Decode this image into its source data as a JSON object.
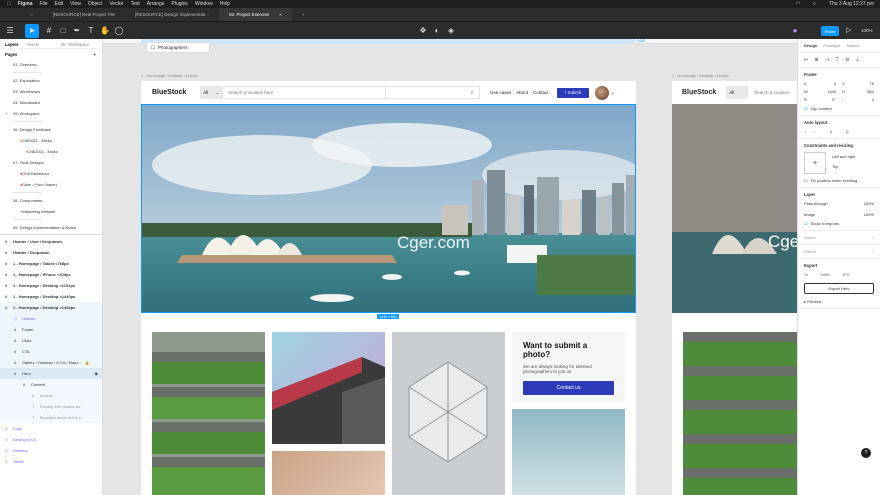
{
  "menubar": {
    "app": "Figma",
    "items": [
      "File",
      "Edit",
      "View",
      "Object",
      "Vector",
      "Text",
      "Arrange",
      "Plugins",
      "Window",
      "Help"
    ],
    "clock": "Thu 3 Aug  12:27 pm"
  },
  "tabs": [
    "[RESOURCE] Real Project File",
    "[RESOURCE] Design Implementati...",
    "03. Project Exercise"
  ],
  "toolbar": {
    "share_label": "Share",
    "zoom": "100%"
  },
  "left_panel": {
    "tabs": [
      "Layers",
      "Assets",
      "05. Workspace"
    ],
    "pages_header": "Pages",
    "pages": [
      {
        "label": "01. Overview"
      },
      {
        "label": "02. Exploration"
      },
      {
        "label": "03. Wireframes"
      },
      {
        "label": "04. Moodboard"
      },
      {
        "label": "05. Workspace"
      },
      {
        "label": "06. Design Feedback"
      },
      {
        "label": "2/8/2021 - Mizko"
      },
      {
        "label": "2/8/2021 - Mizko"
      },
      {
        "label": "07. Final Designs"
      },
      {
        "label": "Grid Behaviour"
      },
      {
        "label": "Date - (Your Name)"
      },
      {
        "label": "08. Components"
      },
      {
        "label": "Marketing Website"
      },
      {
        "label": "09. Design Implementation & Notes"
      }
    ],
    "layers": [
      {
        "label": "Header / User / Dropdown"
      },
      {
        "label": "Header / Dropdown"
      },
      {
        "label": "1 - Homepage / Tablet <768px"
      },
      {
        "label": "1 - Homepage / iPhone <320px"
      },
      {
        "label": "1 - Homepage / Desktop >1152px"
      },
      {
        "label": "1 - Homepage / Desktop >1440px"
      },
      {
        "label": "1 - Homepage / Desktop >1440px"
      },
      {
        "label": "Header"
      },
      {
        "label": "Footer"
      },
      {
        "label": "Links"
      },
      {
        "label": "CTA"
      },
      {
        "label": "Gallery / Desktop / 4 Col / Maso..."
      },
      {
        "label": "Hero"
      },
      {
        "label": "Content"
      },
      {
        "label": "Actions"
      },
      {
        "label": "Royalty free photos an..."
      },
      {
        "label": "Beautiful aerial drone p..."
      },
      {
        "label": "Logo"
      },
      {
        "label": "Desktop (XL)"
      },
      {
        "label": "Desktop"
      },
      {
        "label": "Tablet"
      }
    ]
  },
  "canvas": {
    "frame_label": "1 - Homepage / Desktop >1440px",
    "frame_label_right": "1 - Homepage / Desktop >1440px",
    "top_dropdown": "Photographers",
    "ruler_value": "1440",
    "dimension_badge": "1440 × 800",
    "watermark": "Cger.com",
    "site": {
      "logo": "BlueStock",
      "select": "All",
      "search_placeholder": "Search a location here",
      "links": [
        "Use cases",
        "About",
        "Contact"
      ],
      "submit": "+ Submit",
      "cta_title": "Want to submit a photo?",
      "cta_text": "We are always looking for talented photographers to join us",
      "cta_button": "Contact us"
    },
    "site_right": {
      "logo": "BlueStock",
      "select": "All",
      "search_placeholder": "Search a location"
    }
  },
  "right_panel": {
    "tabs": [
      "Design",
      "Prototype",
      "Inspect"
    ],
    "frame_title": "Frame",
    "x": "0",
    "y": "76",
    "w": "1440",
    "h": "800",
    "rot": "0°",
    "radius": "0",
    "clip": "Clip content",
    "auto_layout": "Auto layout",
    "al_values": [
      "0",
      "0"
    ],
    "constraints_title": "Constraints and resizing",
    "constraint_h": "Left and right",
    "constraint_v": "Top",
    "fix_scroll": "Fix position when scrolling",
    "layer_title": "Layer",
    "blend": "Pass through",
    "opacity": "100%",
    "fill_label": "Image",
    "fill_opacity": "100%",
    "show_exports": "Show in exports",
    "strokes": "Stroke",
    "effects": "Effects",
    "export_title": "Export",
    "export_scale": "1x",
    "export_suffix": "Suffix",
    "export_format": "JPG",
    "export_button": "Export Hero",
    "preview": "Preview"
  }
}
